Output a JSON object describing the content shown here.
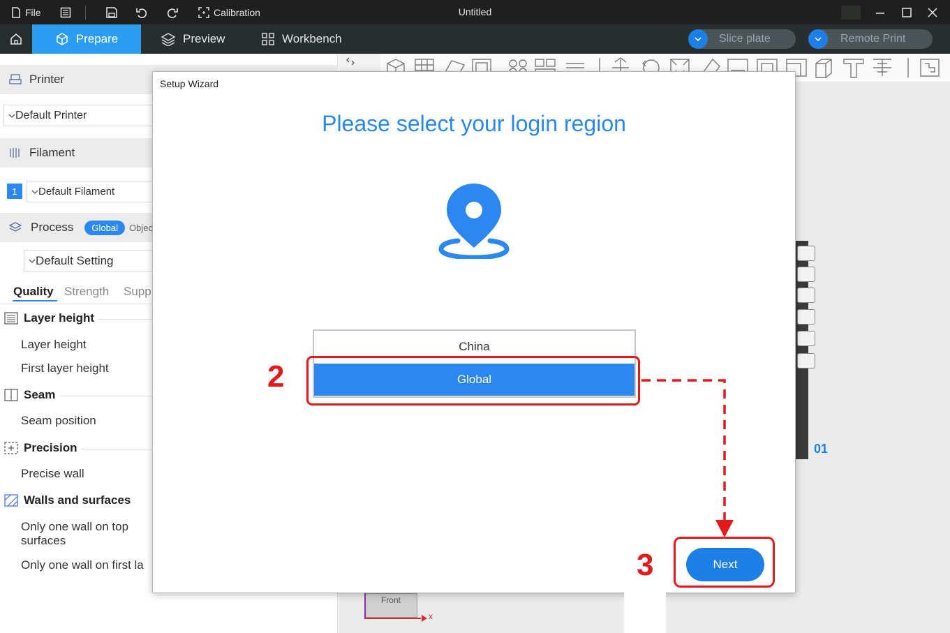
{
  "titlebar": {
    "file_label": "File",
    "calibration_label": "Calibration",
    "window_title": "Untitled"
  },
  "tabs": {
    "prepare": "Prepare",
    "preview": "Preview",
    "workbench": "Workbench",
    "slice_plate": "Slice plate",
    "remote_print": "Remote Print"
  },
  "sidebar": {
    "printer_label": "Printer",
    "printer_value": "Default Printer",
    "filament_label": "Filament",
    "filament_index": "1",
    "filament_value": "Default Filament",
    "process_label": "Process",
    "process_global": "Global",
    "process_object": "Objec",
    "process_value": "Default Setting",
    "quality_tabs": [
      "Quality",
      "Strength",
      "Supp"
    ],
    "groups": {
      "layer_height": "Layer height",
      "seam": "Seam",
      "precision": "Precision",
      "walls": "Walls and surfaces"
    },
    "options": {
      "layer_height": "Layer height",
      "first_layer_height": "First layer height",
      "seam_position": "Seam position",
      "precise_wall": "Precise wall",
      "one_wall_top_1": "Only one wall on top",
      "one_wall_top_2": "surfaces",
      "one_wall_first": "Only one wall on first la"
    }
  },
  "canvas": {
    "plate_label": "01",
    "front_label": "Front",
    "axis_x": "x"
  },
  "dialog": {
    "title": "Setup Wizard",
    "heading": "Please select your login region",
    "regions": [
      "China",
      "Global"
    ],
    "selected_region": "Global",
    "next_label": "Next"
  },
  "annotations": {
    "step_2": "2",
    "step_3": "3"
  },
  "colors": {
    "accent": "#2c88f0",
    "annotation": "#e41a1a",
    "titlebar": "#1f1f1f",
    "tabbar": "#262e30"
  }
}
